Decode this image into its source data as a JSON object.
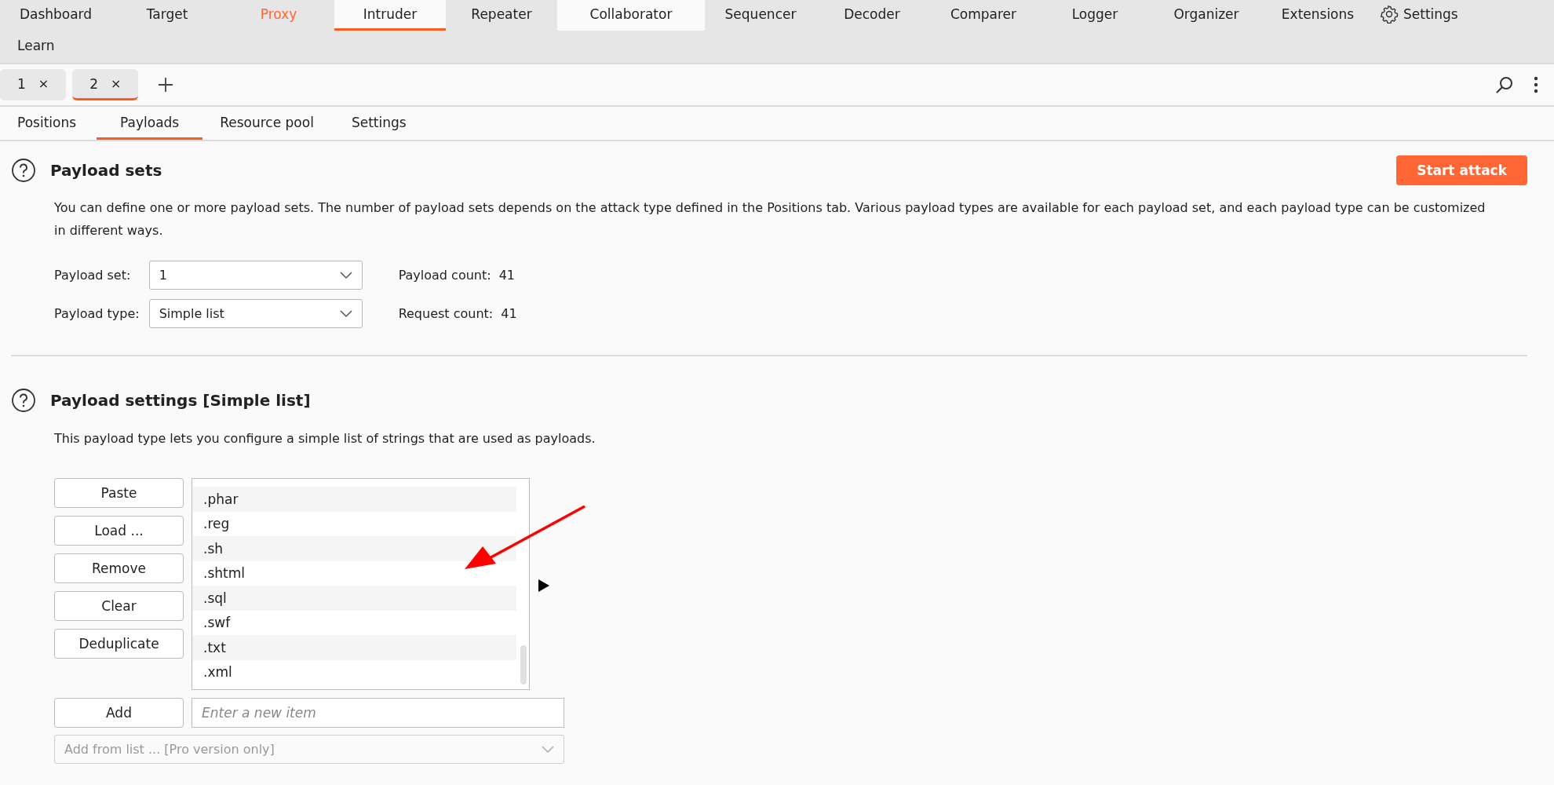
{
  "nav_rows": [
    [
      {
        "label": "Dashboard",
        "selected": false,
        "alert": false,
        "hover": false
      },
      {
        "label": "Target",
        "selected": false,
        "alert": false,
        "hover": false
      },
      {
        "label": "Proxy",
        "selected": false,
        "alert": true,
        "hover": false
      },
      {
        "label": "Intruder",
        "selected": true,
        "alert": false,
        "hover": false
      },
      {
        "label": "Repeater",
        "selected": false,
        "alert": false,
        "hover": false
      },
      {
        "label": "Collaborator",
        "selected": false,
        "alert": false,
        "hover": true
      },
      {
        "label": "Sequencer",
        "selected": false,
        "alert": false,
        "hover": false
      },
      {
        "label": "Decoder",
        "selected": false,
        "alert": false,
        "hover": false
      },
      {
        "label": "Comparer",
        "selected": false,
        "alert": false,
        "hover": false
      },
      {
        "label": "Logger",
        "selected": false,
        "alert": false,
        "hover": false
      },
      {
        "label": "Organizer",
        "selected": false,
        "alert": false,
        "hover": false
      },
      {
        "label": "Extensions",
        "selected": false,
        "alert": false,
        "hover": false
      },
      {
        "label": "Settings",
        "selected": false,
        "alert": false,
        "hover": false,
        "kind": "settings"
      }
    ],
    [
      {
        "label": "Learn",
        "selected": false,
        "alert": false,
        "hover": false
      }
    ]
  ],
  "attack_tabs": [
    {
      "label": "1",
      "close": "×",
      "selected": false
    },
    {
      "label": "2",
      "close": "×",
      "selected": true
    }
  ],
  "sub_tabs": [
    {
      "label": "Positions",
      "selected": false
    },
    {
      "label": "Payloads",
      "selected": true
    },
    {
      "label": "Resource pool",
      "selected": false
    },
    {
      "label": "Settings",
      "selected": false
    }
  ],
  "payload_sets": {
    "title": "Payload sets",
    "start_button": "Start attack",
    "description": "You can define one or more payload sets. The number of payload sets depends on the attack type defined in the Positions tab. Various payload types are available for each payload set, and each payload type can be customized in different ways.",
    "fields": [
      {
        "label": "Payload set:",
        "value": "1",
        "info_label": "Payload count:",
        "info_value": "41"
      },
      {
        "label": "Payload type:",
        "value": "Simple list",
        "info_label": "Request count:",
        "info_value": "41"
      }
    ]
  },
  "payload_settings": {
    "title": "Payload settings [Simple list]",
    "description": "This payload type lets you configure a simple list of strings that are used as payloads.",
    "buttons": [
      "Paste",
      "Load ...",
      "Remove",
      "Clear",
      "Deduplicate"
    ],
    "list_items": [
      ".phar",
      ".reg",
      ".sh",
      ".shtml",
      ".sql",
      ".swf",
      ".txt",
      ".xml"
    ],
    "add_button": "Add",
    "add_placeholder": "Enter a new item",
    "add_from_list": {
      "value": "Add from list ... [Pro version only]",
      "disabled": true
    }
  }
}
